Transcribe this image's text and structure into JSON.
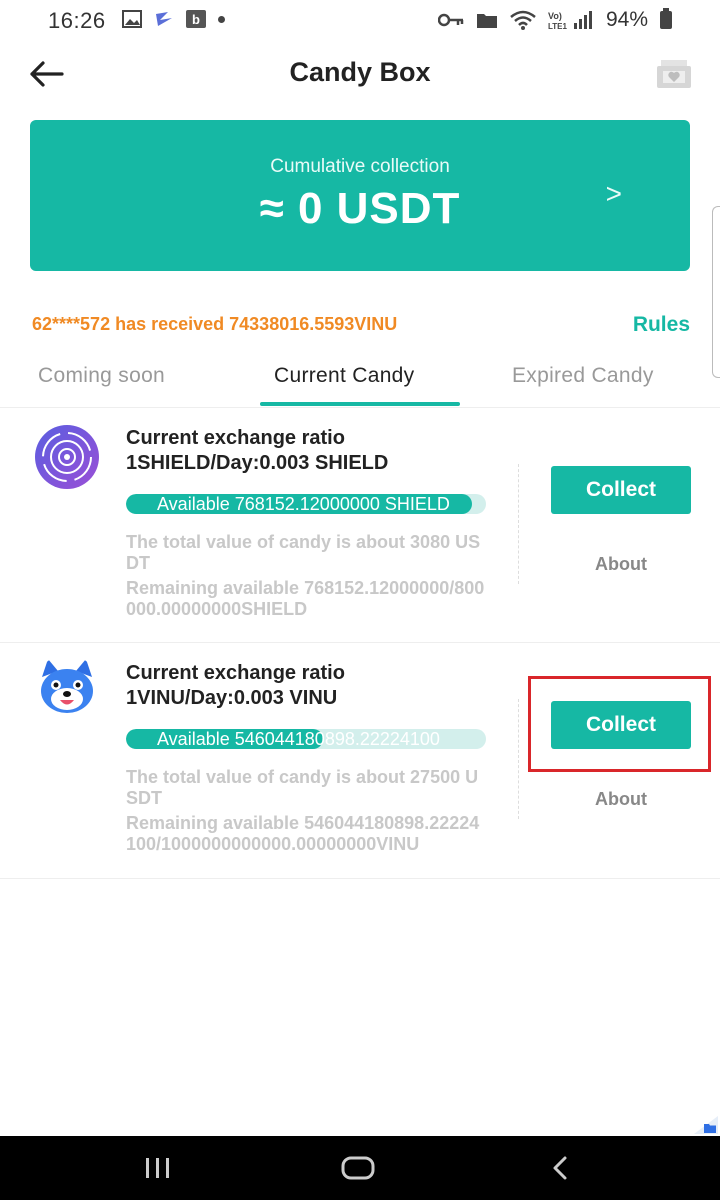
{
  "status_bar": {
    "time": "16:26",
    "notif_b": "b",
    "battery": "94%"
  },
  "header": {
    "title": "Candy Box"
  },
  "banner": {
    "label": "Cumulative collection",
    "value": "≈ 0 USDT",
    "chevron": ">"
  },
  "notice": {
    "text": "62****572 has received 74338016.5593VINU",
    "rules_label": "Rules"
  },
  "tabs": [
    {
      "label": "Coming soon",
      "active": false
    },
    {
      "label": "Current Candy",
      "active": true
    },
    {
      "label": "Expired Candy",
      "active": false
    }
  ],
  "candies": [
    {
      "title_line1": "Current exchange ratio",
      "title_line2": "1SHIELD/Day:0.003 SHIELD",
      "available": "Available 768152.12000000 SHIELD",
      "progress_fraction": 0.96,
      "total_value": "The total value of candy is about 3080 USDT",
      "remaining": "Remaining available 768152.12000000/800000.00000000SHIELD",
      "collect_label": "Collect",
      "about_label": "About",
      "icon": "shield-token-icon"
    },
    {
      "title_line1": "Current exchange ratio",
      "title_line2": "1VINU/Day:0.003 VINU",
      "available": "Available 546044180898.22224100",
      "progress_fraction": 0.546,
      "total_value": "The total value of candy is about 27500 USDT",
      "remaining": "Remaining available 546044180898.22224100/1000000000000.00000000VINU",
      "collect_label": "Collect",
      "about_label": "About",
      "icon": "vinu-token-icon"
    }
  ],
  "colors": {
    "accent": "#16b8a4",
    "notice": "#f08a24",
    "highlight": "#d9262a"
  }
}
